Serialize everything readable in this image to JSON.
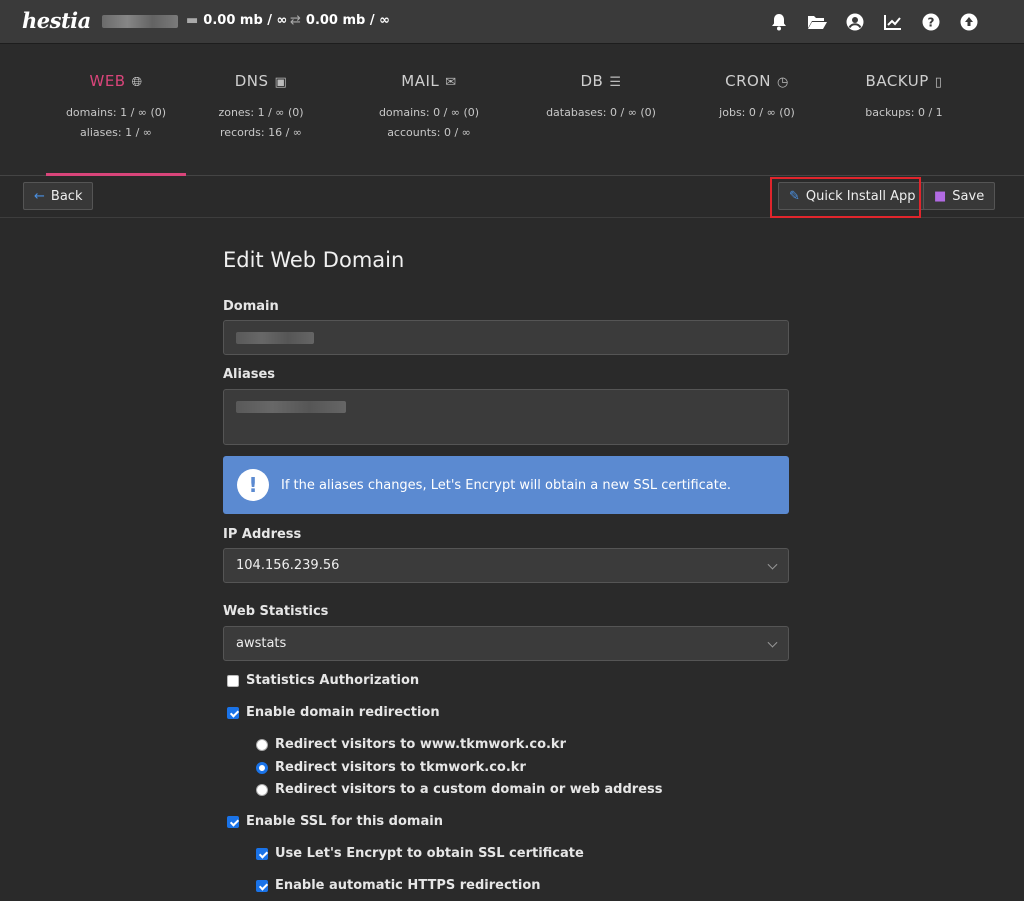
{
  "app": {
    "logo_text": "hestia"
  },
  "topbar": {
    "disk_usage": "0.00 mb / ∞",
    "bandwidth_usage": "0.00 mb / ∞"
  },
  "nav": [
    {
      "title": "WEB",
      "icon": "globe-icon",
      "lines": [
        "domains: 1 / ∞ (0)",
        "aliases: 1 / ∞"
      ]
    },
    {
      "title": "DNS",
      "icon": "book-icon",
      "lines": [
        "zones: 1 / ∞ (0)",
        "records: 16 / ∞"
      ]
    },
    {
      "title": "MAIL",
      "icon": "mail-icon",
      "lines": [
        "domains: 0 / ∞ (0)",
        "accounts: 0 / ∞"
      ]
    },
    {
      "title": "DB",
      "icon": "database-icon",
      "lines": [
        "databases: 0 / ∞ (0)"
      ]
    },
    {
      "title": "CRON",
      "icon": "clock-icon",
      "lines": [
        "jobs: 0 / ∞ (0)"
      ]
    },
    {
      "title": "BACKUP",
      "icon": "file-zip-icon",
      "lines": [
        "backups: 0 / 1"
      ]
    }
  ],
  "toolbar": {
    "back_label": "Back",
    "quick_install_label": "Quick Install App",
    "save_label": "Save"
  },
  "form": {
    "heading": "Edit Web Domain",
    "domain_label": "Domain",
    "aliases_label": "Aliases",
    "alert_text": "If the aliases changes, Let's Encrypt will obtain a new SSL certificate.",
    "ip_label": "IP Address",
    "ip_value": "104.156.239.56",
    "stats_label": "Web Statistics",
    "stats_value": "awstats",
    "stats_auth_label": "Statistics Authorization",
    "stats_auth_checked": false,
    "redirect_label": "Enable domain redirection",
    "redirect_checked": true,
    "redirect_options": [
      "Redirect visitors to www.tkmwork.co.kr",
      "Redirect visitors to tkmwork.co.kr",
      "Redirect visitors to a custom domain or web address"
    ],
    "redirect_selected_index": 1,
    "ssl_label": "Enable SSL for this domain",
    "ssl_checked": true,
    "letsencrypt_label": "Use Let's Encrypt to obtain SSL certificate",
    "letsencrypt_checked": true,
    "https_redirect_label": "Enable automatic HTTPS redirection",
    "https_redirect_checked": true
  },
  "colors": {
    "accent": "#d9457a",
    "alert": "#5b8ad1",
    "highlight": "#e0252c",
    "checkbox": "#1a73e8"
  }
}
